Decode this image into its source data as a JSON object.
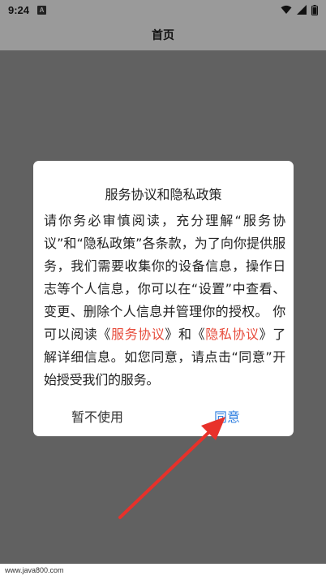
{
  "status_bar": {
    "time": "9:24",
    "badge": "A",
    "icons": [
      "wifi-icon",
      "signal-icon",
      "battery-icon"
    ]
  },
  "app_bar": {
    "title": "首页"
  },
  "dialog": {
    "title": "服务协议和隐私政策",
    "body_intro": "请你务必审慎阅读，充分理解“服务协议”和“隐私政策”各条款，为了向你提供服务，我们需要收集你的设备信息，操作日志等个人信息，你可以在“设置”中查看、变更、删除个人信息并管理你的授权。 你可以阅读",
    "open_quote_1": "《",
    "link_service": "服务协议",
    "close_quote_1": "》",
    "and_text": "和",
    "open_quote_2": "《",
    "link_privacy": "隐私协议",
    "close_quote_2": "》",
    "body_outro": "了解详细信息。如您同意，请点击“同意”开始授受我们的服务。",
    "decline_label": "暂不使用",
    "agree_label": "同意"
  },
  "watermark": "www.java800.com",
  "colors": {
    "overlay": "#616161",
    "topbar": "#9a9a9a",
    "link_red": "#e74c3c",
    "agree_blue": "#2f7fe0",
    "arrow": "#e8312a"
  }
}
